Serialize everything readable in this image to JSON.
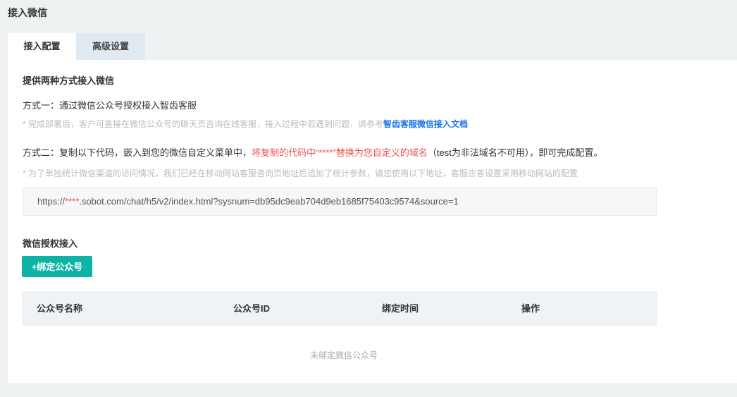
{
  "page": {
    "title": "接入微信"
  },
  "tabs": [
    {
      "label": "接入配置",
      "active": true
    },
    {
      "label": "高级设置",
      "active": false
    }
  ],
  "content": {
    "heading": "提供两种方式接入微信",
    "method1": {
      "text": "方式一：通过微信公众号授权接入智齿客服",
      "hint": "* 完成部署后，客户可直接在微信公众号的聊天页咨询在线客服，接入过程中若遇到问题，请参考",
      "link": "智齿客服微信接入文档"
    },
    "method2": {
      "prefix": "方式二：复制以下代码，嵌入到您的微信自定义菜单中，",
      "highlight": "将复制的代码中“****”替换为您自定义的域名",
      "suffix": "（test为非法域名不可用），即可完成配置。",
      "hint": "* 为了单独统计微信渠道的访问情况，我们已经在移动网站客服咨询页地址后追加了统计参数，请您使用以下地址，客服应答设置采用移动网站的配置"
    },
    "url": {
      "prefix": "https://",
      "placeholder": "****",
      "suffix": ".sobot.com/chat/h5/v2/index.html?sysnum=db95dc9eab704d9eb1685f75403c9574&source=1"
    },
    "auth_section": {
      "title": "微信授权接入",
      "bind_button": "+绑定公众号"
    },
    "table": {
      "columns": [
        "公众号名称",
        "公众号ID",
        "绑定时间",
        "操作"
      ],
      "empty_text": "未绑定微信公众号"
    }
  },
  "colors": {
    "accent": "#0db3a6",
    "link": "#1a73e8",
    "warning": "#ef4f4f"
  }
}
